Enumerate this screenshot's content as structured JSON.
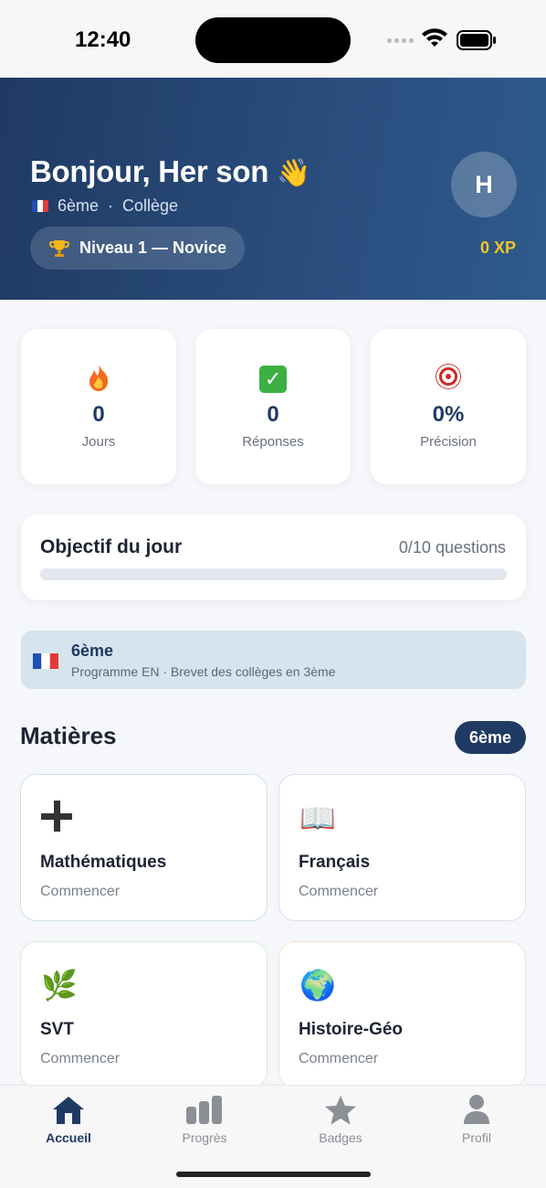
{
  "status_bar": {
    "time": "12:40"
  },
  "header": {
    "greeting": "Bonjour, Her son",
    "wave_emoji": "👋",
    "grade": "6ème",
    "school": "Collège",
    "separator": "·",
    "level": "Niveau 1 — Novice",
    "avatar_initial": "H",
    "xp": "0 XP"
  },
  "stats": [
    {
      "icon": "fire-icon",
      "value": "0",
      "label": "Jours"
    },
    {
      "icon": "check-icon",
      "value": "0",
      "label": "Réponses"
    },
    {
      "icon": "target-icon",
      "value": "0%",
      "label": "Précision"
    }
  ],
  "goal": {
    "title": "Objectif du jour",
    "count": "0/10 questions",
    "progress": 0
  },
  "program": {
    "grade": "6ème",
    "description": "Programme EN · Brevet des collèges en 3ème"
  },
  "subjects_section": {
    "title": "Matières",
    "badge": "6ème"
  },
  "subjects": [
    {
      "icon": "plus-icon",
      "name": "Mathématiques",
      "action": "Commencer"
    },
    {
      "icon": "book-icon",
      "emoji": "📖",
      "name": "Français",
      "action": "Commencer"
    },
    {
      "icon": "herb-icon",
      "emoji": "🌿",
      "name": "SVT",
      "action": "Commencer"
    },
    {
      "icon": "globe-icon",
      "emoji": "🌍",
      "name": "Histoire-Géo",
      "action": "Commencer"
    }
  ],
  "tabs": [
    {
      "label": "Accueil",
      "active": true
    },
    {
      "label": "Progrès",
      "active": false
    },
    {
      "label": "Badges",
      "active": false
    },
    {
      "label": "Profil",
      "active": false
    }
  ],
  "colors": {
    "primary": "#1f3a63",
    "accent_xp": "#f3c623",
    "banner_bg": "#d5e4ee"
  }
}
